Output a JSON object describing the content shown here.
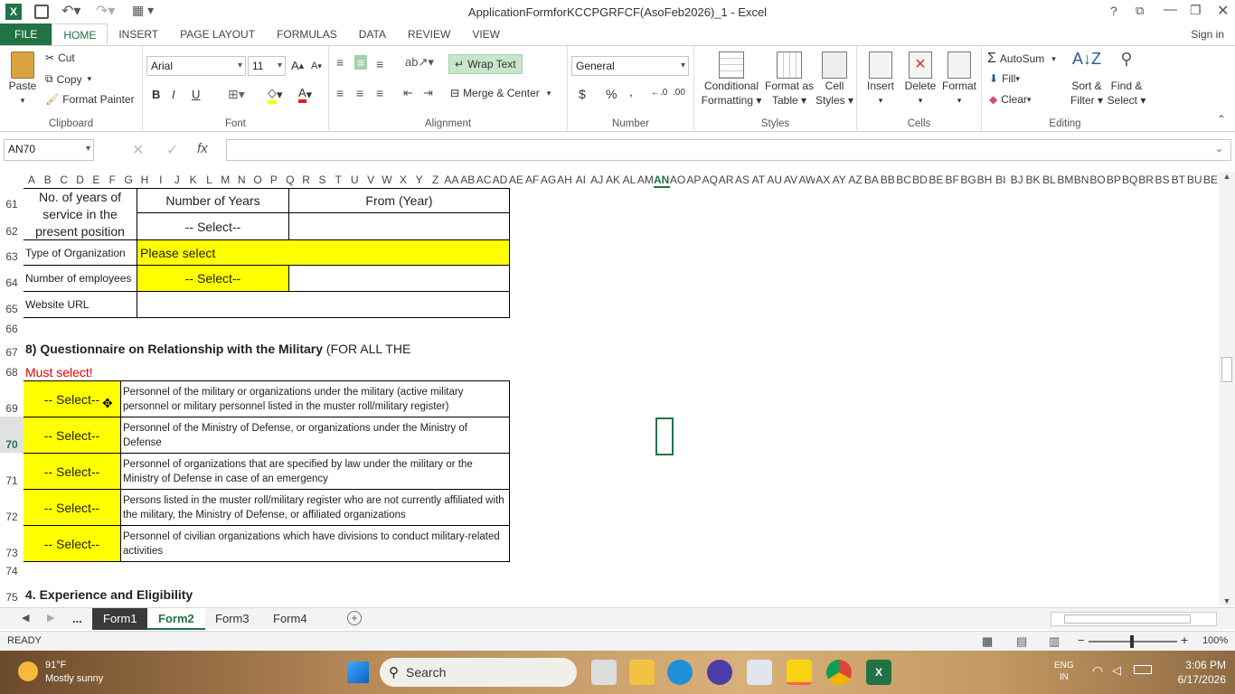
{
  "window": {
    "title": "ApplicationFormforKCCPGRFCF(AsoFeb2026)_1 - Excel",
    "signin": "Sign in"
  },
  "tabs": [
    "FILE",
    "HOME",
    "INSERT",
    "PAGE LAYOUT",
    "FORMULAS",
    "DATA",
    "REVIEW",
    "VIEW"
  ],
  "clipboard": {
    "paste": "Paste",
    "cut": "Cut",
    "copy": "Copy",
    "painter": "Format Painter",
    "label": "Clipboard"
  },
  "font": {
    "name": "Arial",
    "size": "11",
    "label": "Font",
    "bold": "B",
    "italic": "I",
    "underline": "U"
  },
  "alignment": {
    "wrap": "Wrap Text",
    "merge": "Merge & Center",
    "label": "Alignment"
  },
  "number": {
    "format": "General",
    "label": "Number",
    "currency": "$",
    "percent": "%",
    "comma": ","
  },
  "styles": {
    "cond": "Conditional",
    "cond2": "Formatting",
    "fmt": "Format as",
    "fmt2": "Table",
    "cell": "Cell",
    "cell2": "Styles",
    "label": "Styles"
  },
  "cells": {
    "insert": "Insert",
    "delete": "Delete",
    "format": "Format",
    "label": "Cells"
  },
  "editing": {
    "autosum": "AutoSum",
    "fill": "Fill",
    "clear": "Clear",
    "sort": "Sort &",
    "sort2": "Filter",
    "find": "Find &",
    "find2": "Select",
    "label": "Editing"
  },
  "formula": {
    "namebox": "AN70",
    "fx": "fx",
    "value": ""
  },
  "columns": [
    "A",
    "B",
    "C",
    "D",
    "E",
    "F",
    "G",
    "H",
    "I",
    "J",
    "K",
    "L",
    "M",
    "N",
    "O",
    "P",
    "Q",
    "R",
    "S",
    "T",
    "U",
    "V",
    "W",
    "X",
    "Y",
    "Z",
    "AA",
    "AB",
    "AC",
    "AD",
    "AE",
    "AF",
    "AG",
    "AH",
    "AI",
    "AJ",
    "AK",
    "AL",
    "AM",
    "AN",
    "AO",
    "AP",
    "AQ",
    "AR",
    "AS",
    "AT",
    "AU",
    "AV",
    "AW",
    "AX",
    "AY",
    "AZ",
    "BA",
    "BB",
    "BC",
    "BD",
    "BE",
    "BF",
    "BG",
    "BH",
    "BI",
    "BJ",
    "BK",
    "BL",
    "BM",
    "BN",
    "BO",
    "BP",
    "BQ",
    "BR",
    "BS",
    "BT",
    "BU",
    "BE"
  ],
  "rows": [
    "61",
    "62",
    "63",
    "64",
    "65",
    "66",
    "67",
    "68",
    "69",
    "70",
    "71",
    "72",
    "73",
    "74",
    "75"
  ],
  "sheet": {
    "years_label": "No. of years of service in the present position",
    "num_years": "Number of Years",
    "from_year": "From (Year)",
    "select": "-- Select--",
    "org_type_label": "Type of Organization",
    "org_type_value": "Please select",
    "employees_label": "Number of employees",
    "website_label": "Website URL",
    "q8_title": "8) Questionnaire on Relationship with the Military",
    "q8_suffix": " (FOR ALL THE",
    "must_select": "Must select!",
    "q_items": [
      "Personnel of the military or organizations under the military (active military personnel or military personnel listed in the muster roll/military register)",
      "Personnel of the Ministry of Defense, or organizations under the Ministry of Defense",
      "Personnel of organizations that are specified by law under the military or the Ministry of Defense in case of an emergency",
      "Persons listed in the muster roll/military register who are not currently affiliated with the military, the Ministry of Defense, or affiliated organizations",
      "Personnel of civilian organizations which have divisions to conduct military-related activities"
    ],
    "section4": "4. Experience and Eligibility"
  },
  "sheettabs": [
    "...",
    "Form1",
    "Form2",
    "Form3",
    "Form4"
  ],
  "status": {
    "ready": "READY",
    "zoom": "100%"
  },
  "taskbar": {
    "temp": "91°F",
    "weather": "Mostly sunny",
    "search": "Search",
    "lang1": "ENG",
    "lang2": "IN",
    "time": "3:06 PM",
    "date": "6/17/2026"
  }
}
